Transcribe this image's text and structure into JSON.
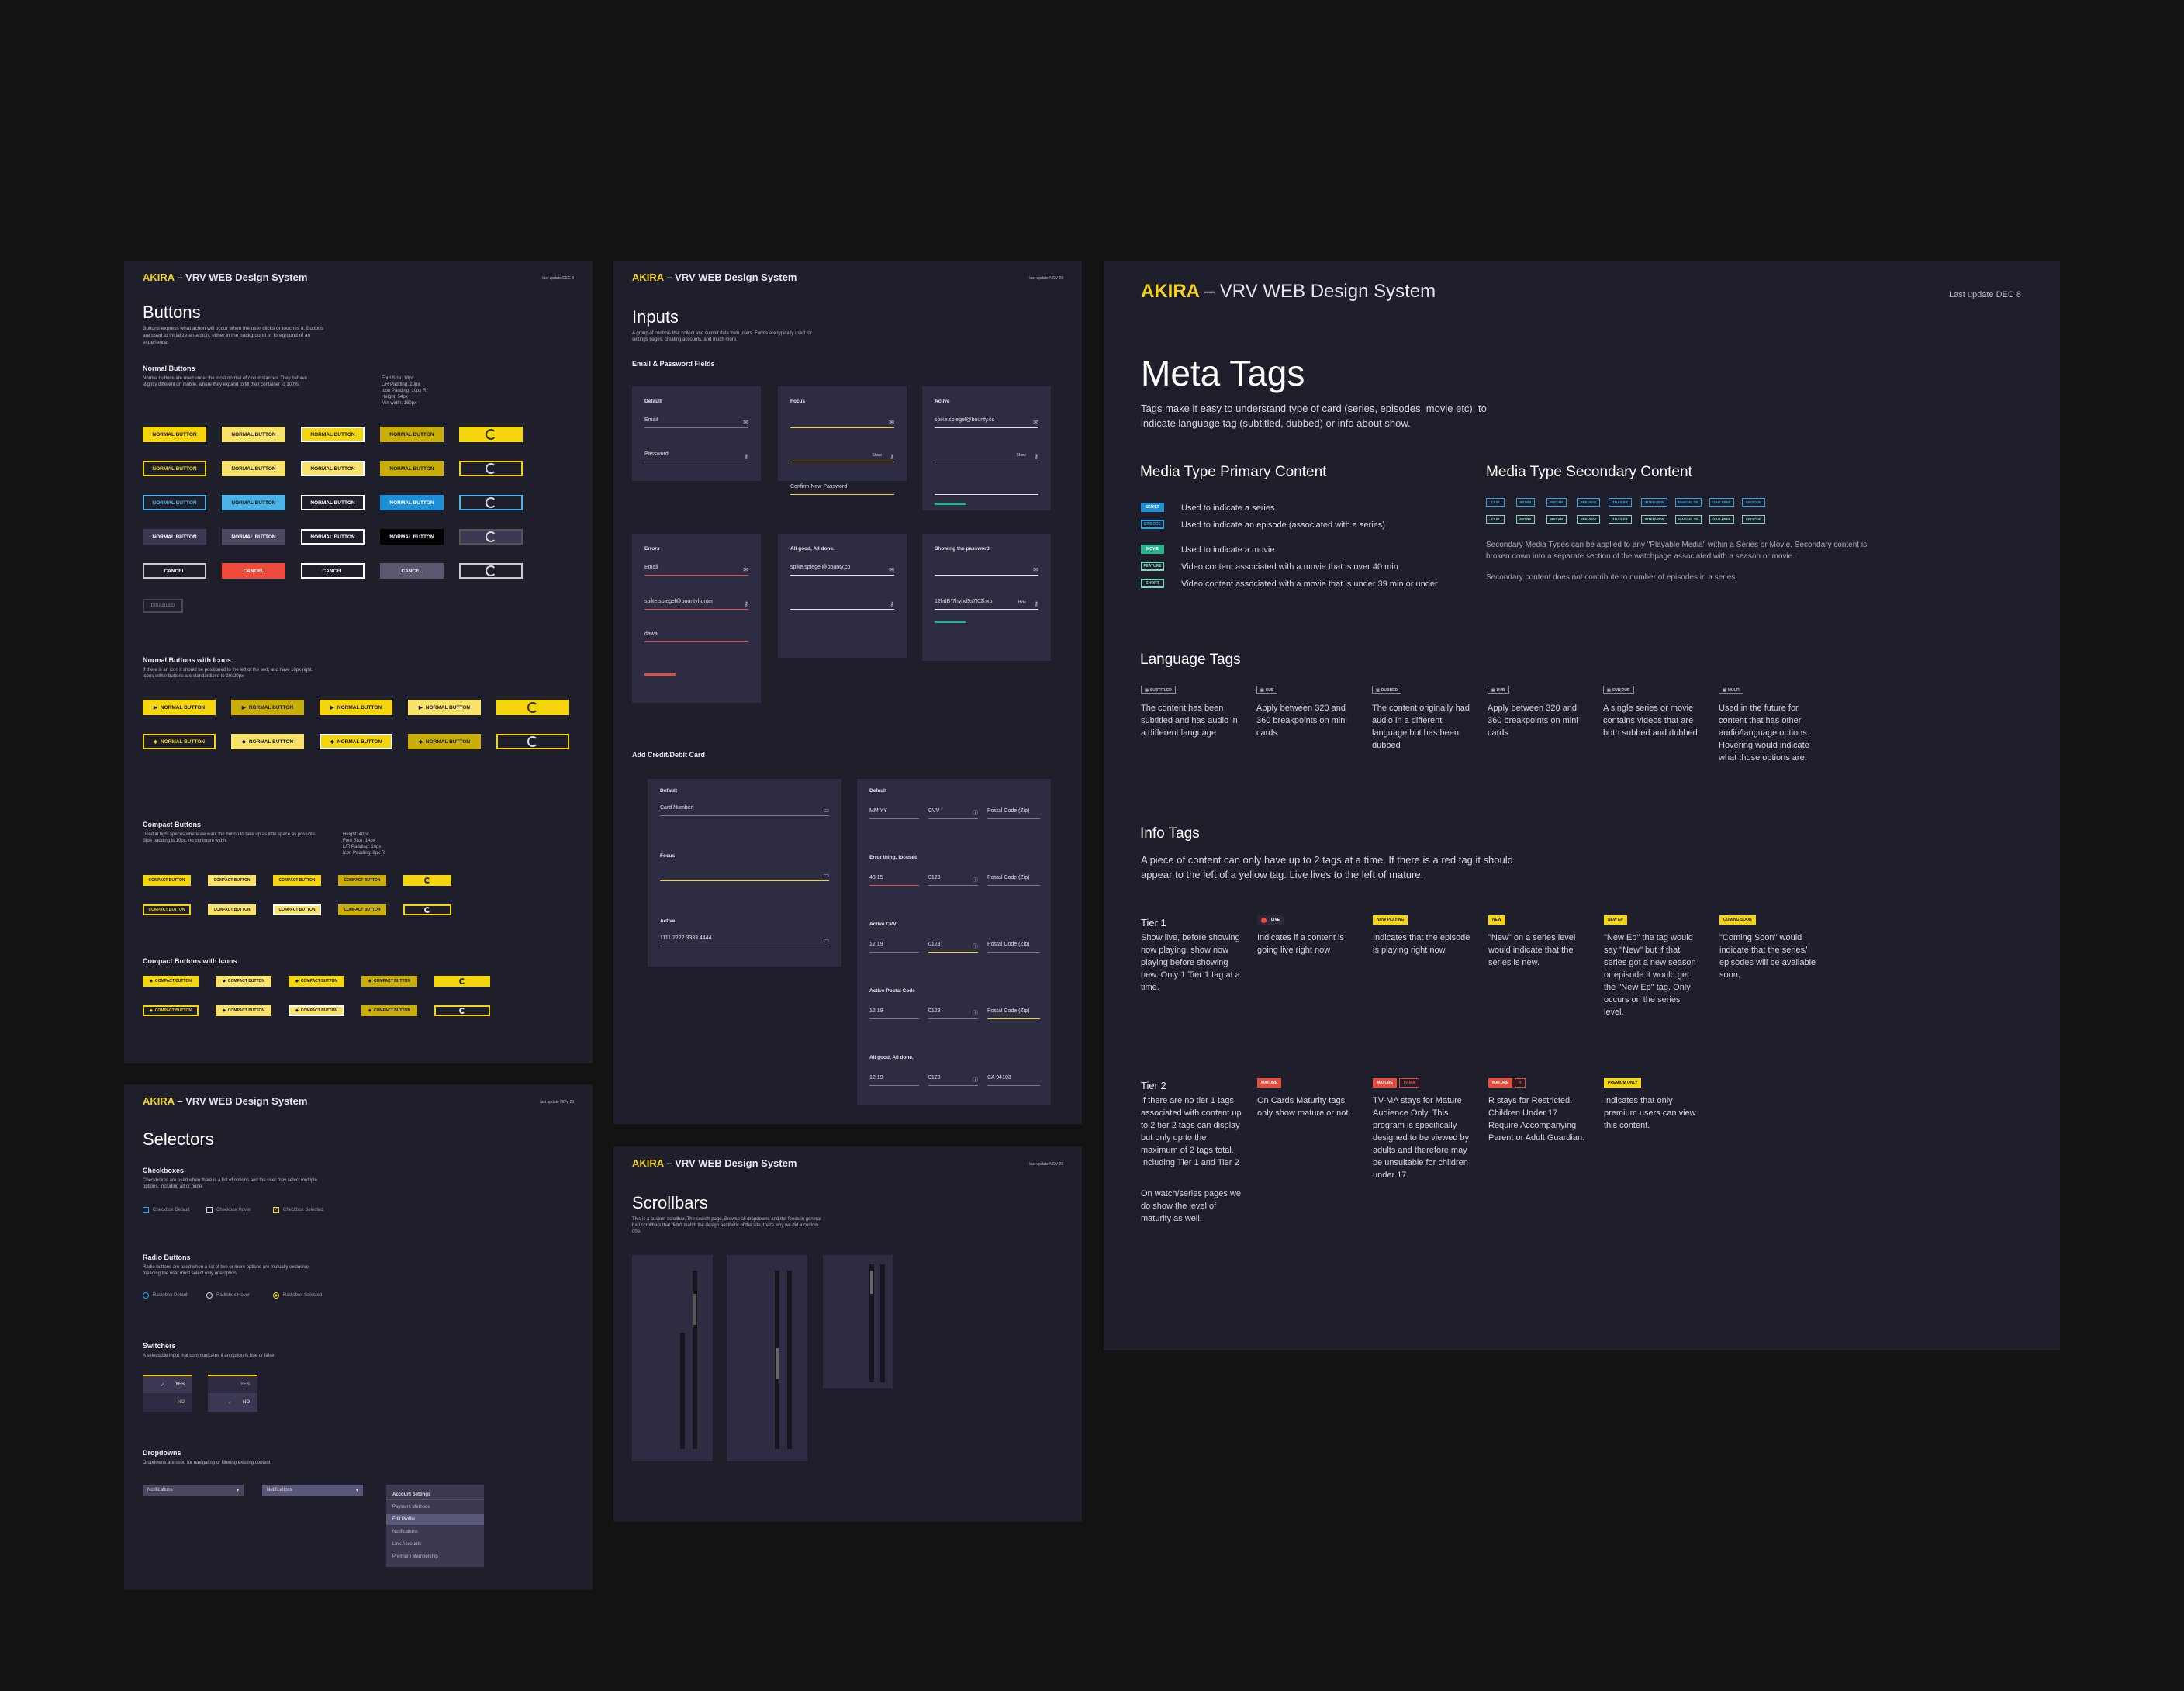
{
  "brand": "AKIRA",
  "system_title": "– VRV WEB Design System",
  "buttons_board": {
    "updated": "last update DEC 8",
    "title": "Buttons",
    "intro": "Buttons express what action will occur when the user clicks or touches it. Buttons are used to initialize an action, either in the background or foreground of an experience.",
    "normal_title": "Normal Buttons",
    "normal_desc": "Normal buttons are used under the most normal of circumstances. They behave slightly different on mobile, where they expand to fill their container to 100%.",
    "normal_spec": "Font Size: 18px\nL/R Padding: 20px\nIcon Padding: 10px R\nHeight: 54px\nMin width: 160px",
    "normal_label": "NORMAL BUTTON",
    "cancel_label": "CANCEL",
    "disabled_label": "DISABLED",
    "icons_title": "Normal Buttons with Icons",
    "icons_desc": "If there is an icon it should be positioned to the left of the text, and have 10px right. Icons within buttons are standardized to 20x20px",
    "compact_title": "Compact Buttons",
    "compact_desc": "Used in tight spaces where we want the button to take up as little space as possible. Side padding is 10px, no minimum width.",
    "compact_spec": "Height: 40px\nFont Size: 14px\nL/R Padding: 10px\nIcon Padding: 8px R",
    "compact_label": "COMPACT BUTTON",
    "compact_icons_title": "Compact Buttons with Icons"
  },
  "inputs_board": {
    "updated": "last update NOV 29",
    "title": "Inputs",
    "intro": "A group of controls that collect and submit data from users. Forms are typically used for settings pages, creating accounts, and much more.",
    "email_section": "Email & Password Fields",
    "panels": [
      {
        "title": "Default",
        "f1": "Email",
        "f2": "Password"
      },
      {
        "title": "Focus",
        "f1": "",
        "f2": "",
        "f3": "Confirm New Password"
      },
      {
        "title": "Active",
        "f1": "spike.spiegel@bounty.co",
        "f2": "",
        "f3": ""
      },
      {
        "title": "Errors",
        "f1": "Email",
        "f2": "spike.spiegel@bountyhunter",
        "f3": "dawa"
      },
      {
        "title": "All good, All done.",
        "f1": "spike.spiegel@bounty.co",
        "f2": ""
      },
      {
        "title": "Showing the password",
        "f1": "",
        "f2": "12hdB*7hyhd9s7!02hxb"
      }
    ],
    "show_label": "Show",
    "hide_label": "Hide",
    "card_section": "Add Credit/Debit Card",
    "card_left": [
      "Default",
      "Focus",
      "Active"
    ],
    "card_number_label": "Card Number",
    "card_number_value": "1111 2222 3333 4444",
    "card_right": [
      "Default",
      "Error thing, focused",
      "Active CVV",
      "Active Postal Code",
      "All good, All done."
    ],
    "expiry": [
      "MM",
      "YY"
    ],
    "expiry_value": [
      "12",
      "19"
    ],
    "expiry_error": [
      "43",
      "15"
    ],
    "cvv_label": "CVV",
    "cvv_value": "0123",
    "postal_label": "Postal Code (Zip)",
    "postal_value": "CA 94103"
  },
  "selectors_board": {
    "updated": "last update NOV 29",
    "title": "Selectors",
    "checkboxes_title": "Checkboxes",
    "checkboxes_desc": "Checkboxes are used when there is a list of options and the user may select multiple options, including all or none.",
    "checkboxes": [
      "Checkbox Default",
      "Checkbox Hover",
      "Checkbox Selected"
    ],
    "radio_title": "Radio Buttons",
    "radio_desc": "Radio buttons are used when a list of two or more options are mutually exclusive, meaning the user must select only one option.",
    "radios": [
      "Radiobox Default",
      "Radiobox Hover",
      "Radiobox Selected"
    ],
    "switchers_title": "Switchers",
    "switchers_desc": "A selectable input that communicates if an option is true or false",
    "yes": "YES",
    "no": "NO",
    "dropdowns_title": "Dropdowns",
    "dropdowns_desc": "Dropdowns are used for navigating or filtering existing content",
    "dropdown_value": "Notifications",
    "menu_items": [
      "Account Settings",
      "Payment Methods",
      "Edit Profile",
      "Notifications",
      "Link Accounts",
      "Premium Membership"
    ]
  },
  "scroll_board": {
    "updated": "last update NOV 29",
    "title": "Scrollbars",
    "intro": "This is a custom scrollbar. The search page, Browse all dropdowns and the feeds in general had scrollbars that didn't match the design aesthetic of the site, that's why we did a custom one."
  },
  "meta": {
    "updated": "Last update DEC 8",
    "title": "Meta Tags",
    "intro": "Tags make it easy to understand type of card (series, episodes, movie etc), to indicate language tag (subtitled, dubbed) or info about show.",
    "primary_title": "Media Type Primary Content",
    "primary": [
      {
        "tag": "SERIES",
        "desc": "Used to indicate a series",
        "bg": "#1d8fd6",
        "fg": "#ffffff"
      },
      {
        "tag": "EPISODE",
        "desc": "Used to indicate an episode (associated with a series)",
        "bg": "#1f1e2b",
        "fg": "#2ba4e6"
      },
      {
        "tag": "MOVIE",
        "desc": "Used to indicate a movie",
        "bg": "#2ab38e",
        "fg": "#ffffff"
      },
      {
        "tag": "FEATURE",
        "desc": "Video content associated with a movie that is over 40 min",
        "bg": "#1f1e2b",
        "fg": "#7fd6bd"
      },
      {
        "tag": "SHORT",
        "desc": "Video content associated with a movie that is under 39 min or under",
        "bg": "#1f1e2b",
        "fg": "#7fd6bd"
      }
    ],
    "secondary_title": "Media Type Secondary Content",
    "secondary_row1": [
      "CLIP",
      "EXTRA",
      "RECAP",
      "PREVIEW",
      "TRAILER",
      "INTERVIEW",
      "MAKING OF",
      "GAG REEL",
      "EPISODE"
    ],
    "secondary_row2": [
      "CLIP",
      "EXTRA",
      "RECAP",
      "PREVIEW",
      "TRAILER",
      "INTERVIEW",
      "MAKING OF",
      "GAG REEL",
      "EPISODE"
    ],
    "secondary_desc1": "Secondary Media Types can be applied to any \"Playable Media\" within a Series or Movie. Secondary content is broken down into a separate section of the watchpage associated with a season or movie.",
    "secondary_desc2": "Secondary content does not contribute to number of episodes in a series.",
    "language_title": "Language Tags",
    "language": [
      {
        "tag": "SUBTITLED",
        "desc": "The content has been subtitled and has audio in a different language"
      },
      {
        "tag": "SUB",
        "desc": "Apply between 320 and 360 breakpoints on mini cards"
      },
      {
        "tag": "DUBBED",
        "desc": "The content originally had audio in a different language but has been dubbed"
      },
      {
        "tag": "DUB",
        "desc": "Apply between 320 and 360 breakpoints on mini cards"
      },
      {
        "tag": "SUB|DUB",
        "desc": "A single series or movie contains videos that are both subbed and dubbed"
      },
      {
        "tag": "MULTI",
        "desc": "Used in the future for content that has other audio/language options. Hovering would indicate what those options are."
      }
    ],
    "info_title": "Info Tags",
    "info_intro": "A piece of content can only have up to 2 tags at a time. If there is a red tag it should appear to the left of a yellow tag. Live lives to the left of mature.",
    "tier1_title": "Tier 1",
    "tier1_desc": "Show live, before showing now playing, show now playing before showing new. Only 1 Tier 1 tag at a time.",
    "tier1": [
      {
        "tag": "LIVE",
        "desc": "Indicates if a content is going live right now",
        "bg": "#2a2838",
        "fg": "#ffffff"
      },
      {
        "tag": "NOW PLAYING",
        "desc": "Indicates that the episode is playing right now",
        "bg": "#f5d50c",
        "fg": "#1a1a1a"
      },
      {
        "tag": "NEW",
        "desc": "\"New\" on a series level would indicate that the series is new.",
        "bg": "#f5d50c",
        "fg": "#1a1a1a"
      },
      {
        "tag": "NEW EP",
        "desc": "\"New Ep\" the tag would say \"New\" but if that series got a new season or episode it would get the \"New Ep\" tag. Only occurs on the series level.",
        "bg": "#f5d50c",
        "fg": "#1a1a1a"
      },
      {
        "tag": "COMING SOON",
        "desc": "\"Coming Soon\" would indicate that the series/ episodes will be available soon.",
        "bg": "#f5d50c",
        "fg": "#1a1a1a"
      }
    ],
    "tier2_title": "Tier 2",
    "tier2_desc": "If there are no tier 1 tags associated with content up to 2 tier 2 tags can display but only up to the maximum of 2 tags total. Including Tier 1 and Tier 2",
    "tier2_desc2": "On watch/series pages we do show the level of maturity as well.",
    "tier2": [
      {
        "tag": "MATURE",
        "extra": "",
        "desc": "On Cards Maturity tags only show mature or not.",
        "bg": "#e84a3b",
        "fg": "#ffffff"
      },
      {
        "tag": "MATURE",
        "extra": "TV-MA",
        "desc": "TV-MA stays for Mature Audience Only. This program is specifically designed to be viewed by adults and therefore may be unsuitable for children under 17.",
        "bg": "#e84a3b",
        "fg": "#ffffff"
      },
      {
        "tag": "MATURE",
        "extra": "R",
        "desc": "R stays for Restricted. Children Under 17 Require Accompanying Parent or Adult Guardian.",
        "bg": "#e84a3b",
        "fg": "#ffffff"
      },
      {
        "tag": "PREMIUM ONLY",
        "extra": "",
        "desc": "Indicates that only premium users can view this content.",
        "bg": "#f5d50c",
        "fg": "#1a1a1a"
      }
    ]
  },
  "colors": {
    "brand_yellow": "#f5d50c",
    "board_bg": "#1f1e2b",
    "page_bg": "#131314",
    "error_red": "#e84a3b",
    "link_blue": "#2ba4e6"
  }
}
